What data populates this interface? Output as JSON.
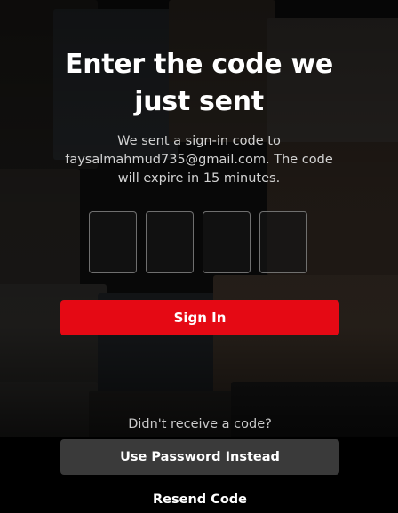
{
  "heading": "Enter the code we just sent",
  "instructions": "We sent a sign-in code to faysalmahmud735@gmail.com. The code will expire in 15 minutes.",
  "code_inputs": [
    {
      "value": ""
    },
    {
      "value": ""
    },
    {
      "value": ""
    },
    {
      "value": ""
    }
  ],
  "sign_in_label": "Sign In",
  "no_code_prompt": "Didn't receive a code?",
  "use_password_label": "Use Password Instead",
  "resend_label": "Resend Code",
  "colors": {
    "accent": "#e50914",
    "secondary_button": "#3a3a3a",
    "background": "#000000"
  }
}
